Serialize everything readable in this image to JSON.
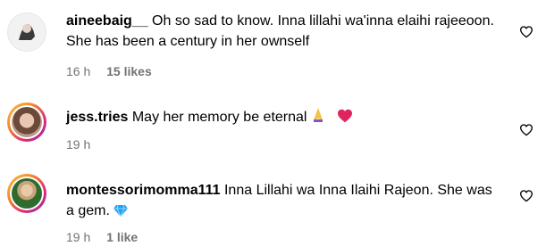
{
  "comments": [
    {
      "username": "aineebaig__",
      "text": " Oh so sad to know. Inna lillahi wa'inna elaihi rajeeoon. She has been a century in her ownself",
      "time": "16 h",
      "likes": "15 likes",
      "avatar_icon": "avatar-default-icon"
    },
    {
      "username": "jess.tries",
      "text": " May her memory be eternal ",
      "time": "19 h",
      "likes": "",
      "emojis": [
        "praying-hands",
        "red-heart"
      ],
      "avatar_icon": "avatar-story-ring"
    },
    {
      "username": "montessorimomma111",
      "text": " Inna Lillahi wa Inna Ilaihi Rajeon. She was a gem.",
      "time": "19 h",
      "likes": "1 like",
      "emojis": [
        "gem"
      ],
      "avatar_icon": "avatar-story-ring"
    }
  ],
  "colors": {
    "meta": "#737373",
    "heart_emoji": "#e0245e",
    "gem_emoji": "#1da1f2"
  }
}
